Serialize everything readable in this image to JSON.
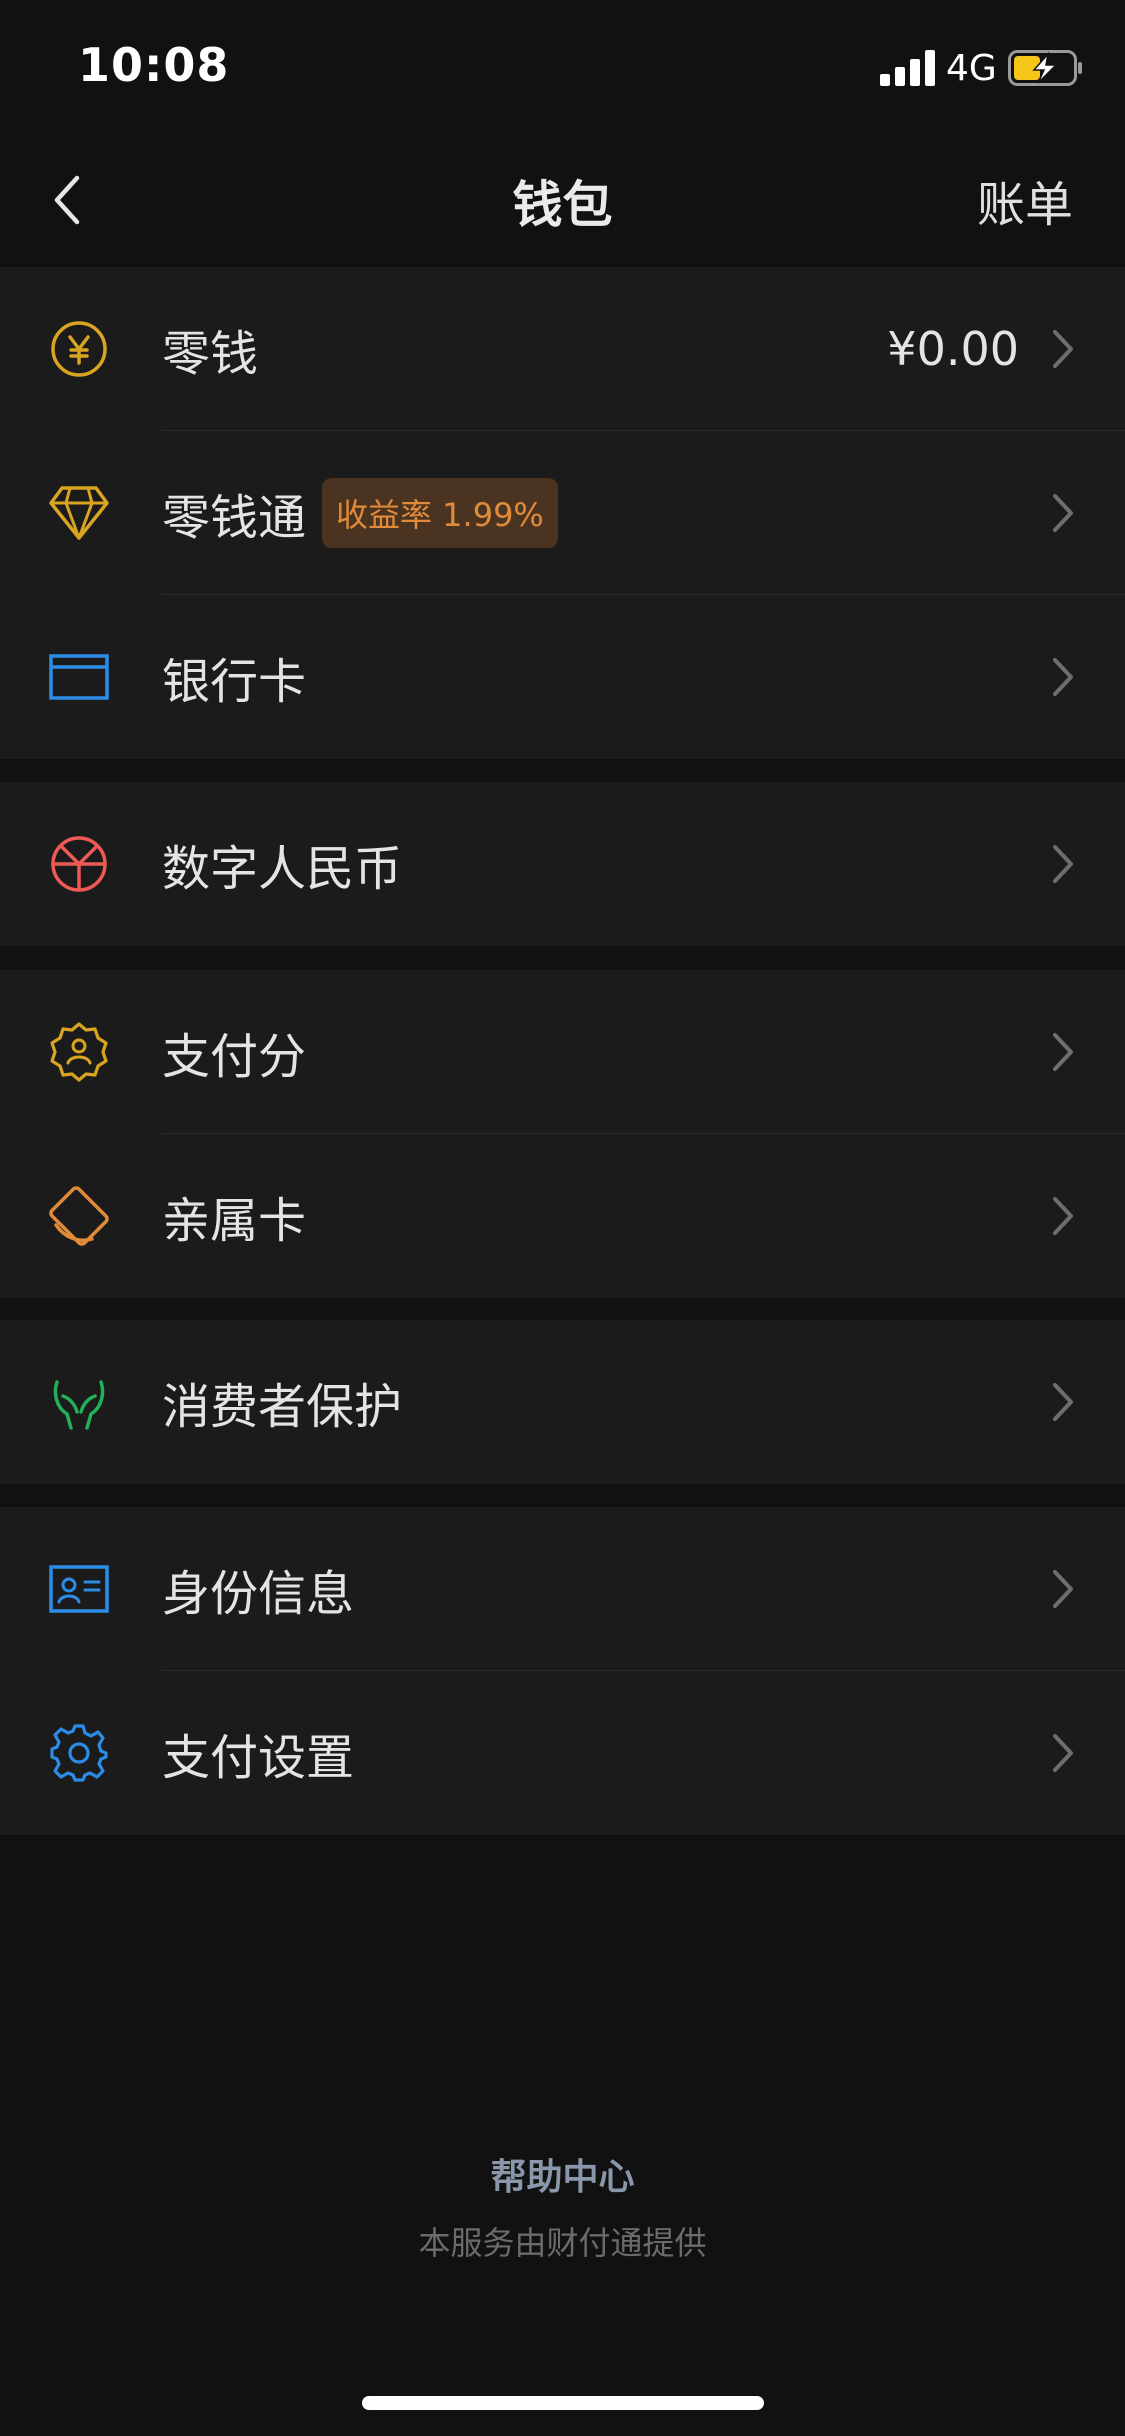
{
  "status_bar": {
    "time": "10:08",
    "network": "4G"
  },
  "nav": {
    "title": "钱包",
    "action": "账单"
  },
  "groups": [
    {
      "items": [
        {
          "label": "零钱",
          "value": "¥0.00",
          "icon": "yuan-coin-icon",
          "color": "#d9a521"
        },
        {
          "label": "零钱通",
          "badge": "收益率 1.99%",
          "icon": "diamond-icon",
          "color": "#d9a521"
        },
        {
          "label": "银行卡",
          "icon": "bank-card-icon",
          "color": "#2b8de8"
        }
      ]
    },
    {
      "items": [
        {
          "label": "数字人民币",
          "icon": "digital-rmb-icon",
          "color": "#f05a55"
        }
      ]
    },
    {
      "items": [
        {
          "label": "支付分",
          "icon": "pay-score-badge-icon",
          "color": "#d9a521"
        },
        {
          "label": "亲属卡",
          "icon": "family-card-icon",
          "color": "#e08a3a"
        }
      ]
    },
    {
      "items": [
        {
          "label": "消费者保护",
          "icon": "protect-hands-icon",
          "color": "#22b05a"
        }
      ]
    },
    {
      "items": [
        {
          "label": "身份信息",
          "icon": "id-card-icon",
          "color": "#2b8de8"
        },
        {
          "label": "支付设置",
          "icon": "gear-icon",
          "color": "#2b8de8"
        }
      ]
    }
  ],
  "footer": {
    "help_link": "帮助中心",
    "note": "本服务由财付通提供"
  }
}
